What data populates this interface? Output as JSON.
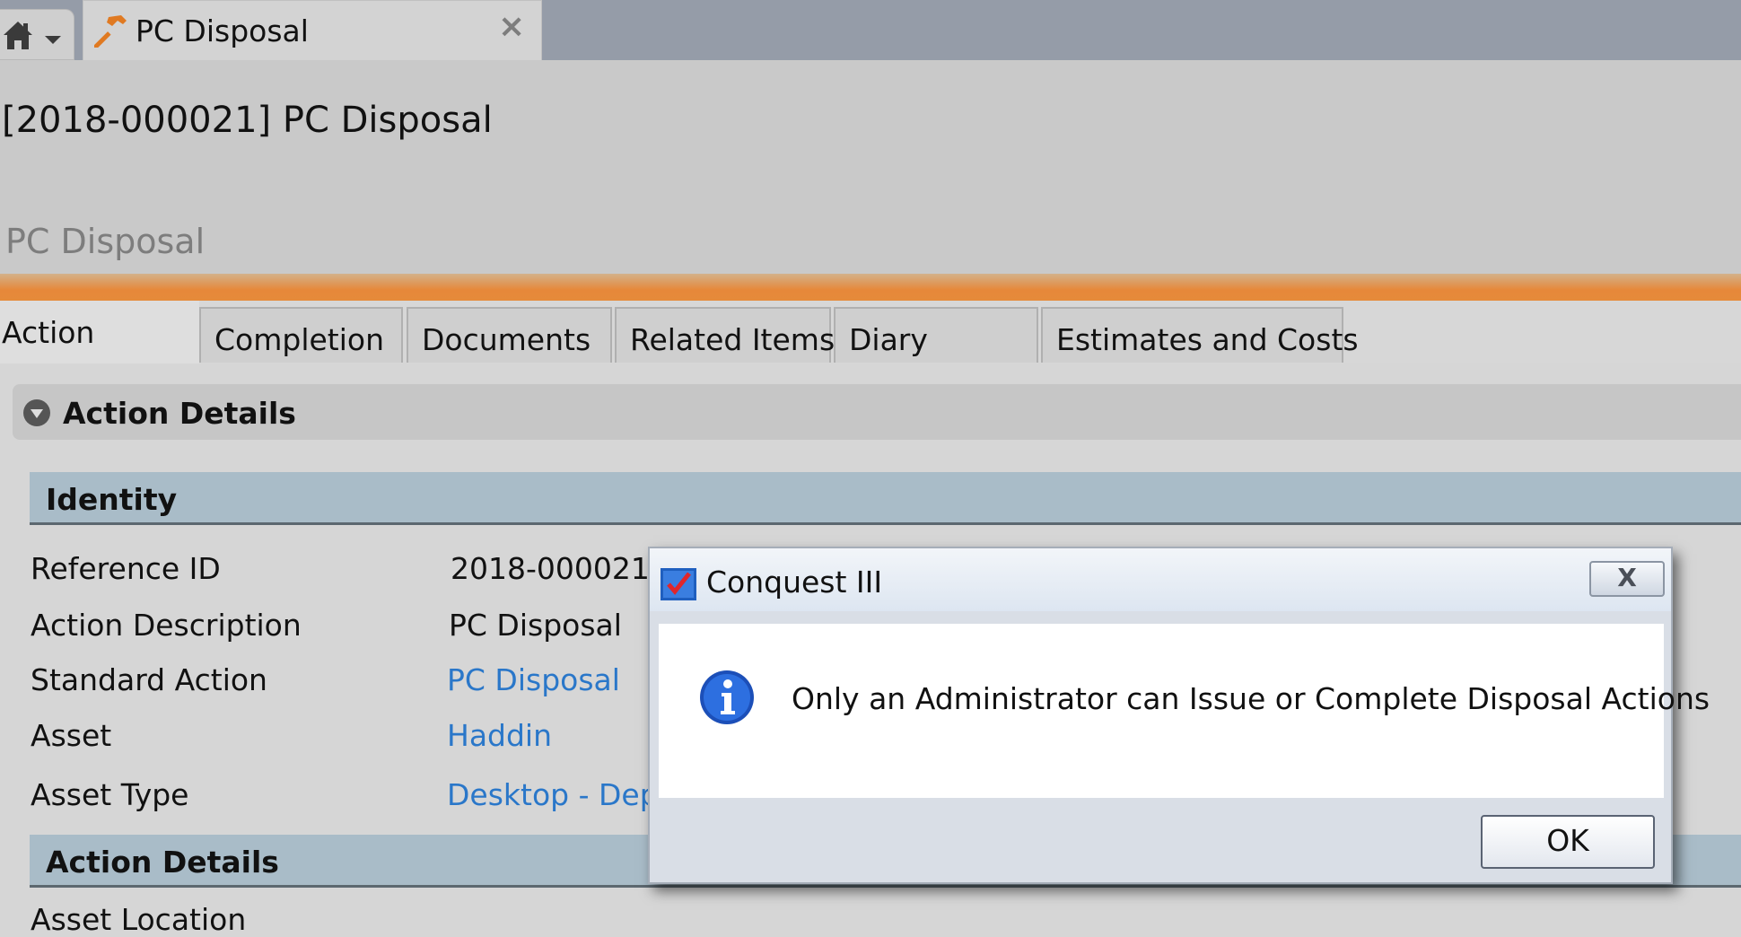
{
  "tabstrip": {
    "home_icon": "home-icon",
    "document_tab": {
      "title": "PC Disposal",
      "icon": "hammer-icon",
      "close": "×"
    }
  },
  "header": {
    "title": "[2018-000021] PC Disposal",
    "subtitle": "PC Disposal"
  },
  "tabs": [
    "Action",
    "Completion",
    "Documents",
    "Related Items",
    "Diary",
    "Estimates and Costs"
  ],
  "section": {
    "title": "Action Details",
    "groups": [
      {
        "title": "Identity",
        "fields": [
          {
            "label": "Reference ID",
            "value": "2018-000021",
            "link": false
          },
          {
            "label": "Action Description",
            "value": "PC Disposal",
            "link": false
          },
          {
            "label": "Standard Action",
            "value": "PC Disposal",
            "link": true
          },
          {
            "label": "Asset",
            "value": "Haddin",
            "link": true
          },
          {
            "label": "Asset Type",
            "value": "Desktop - Depr",
            "link": true
          }
        ]
      },
      {
        "title": "Action Details",
        "fields": [
          {
            "label": "Asset Location",
            "value": "",
            "link": false
          }
        ]
      }
    ]
  },
  "dialog": {
    "title": "Conquest III",
    "close_label": "X",
    "message": "Only an Administrator can Issue or Complete Disposal Actions",
    "icon": "info-icon",
    "ok_label": "OK"
  },
  "colors": {
    "accent_orange": "#e5883a",
    "link_blue": "#2a77c9",
    "group_bar": "#a9bcc8"
  }
}
